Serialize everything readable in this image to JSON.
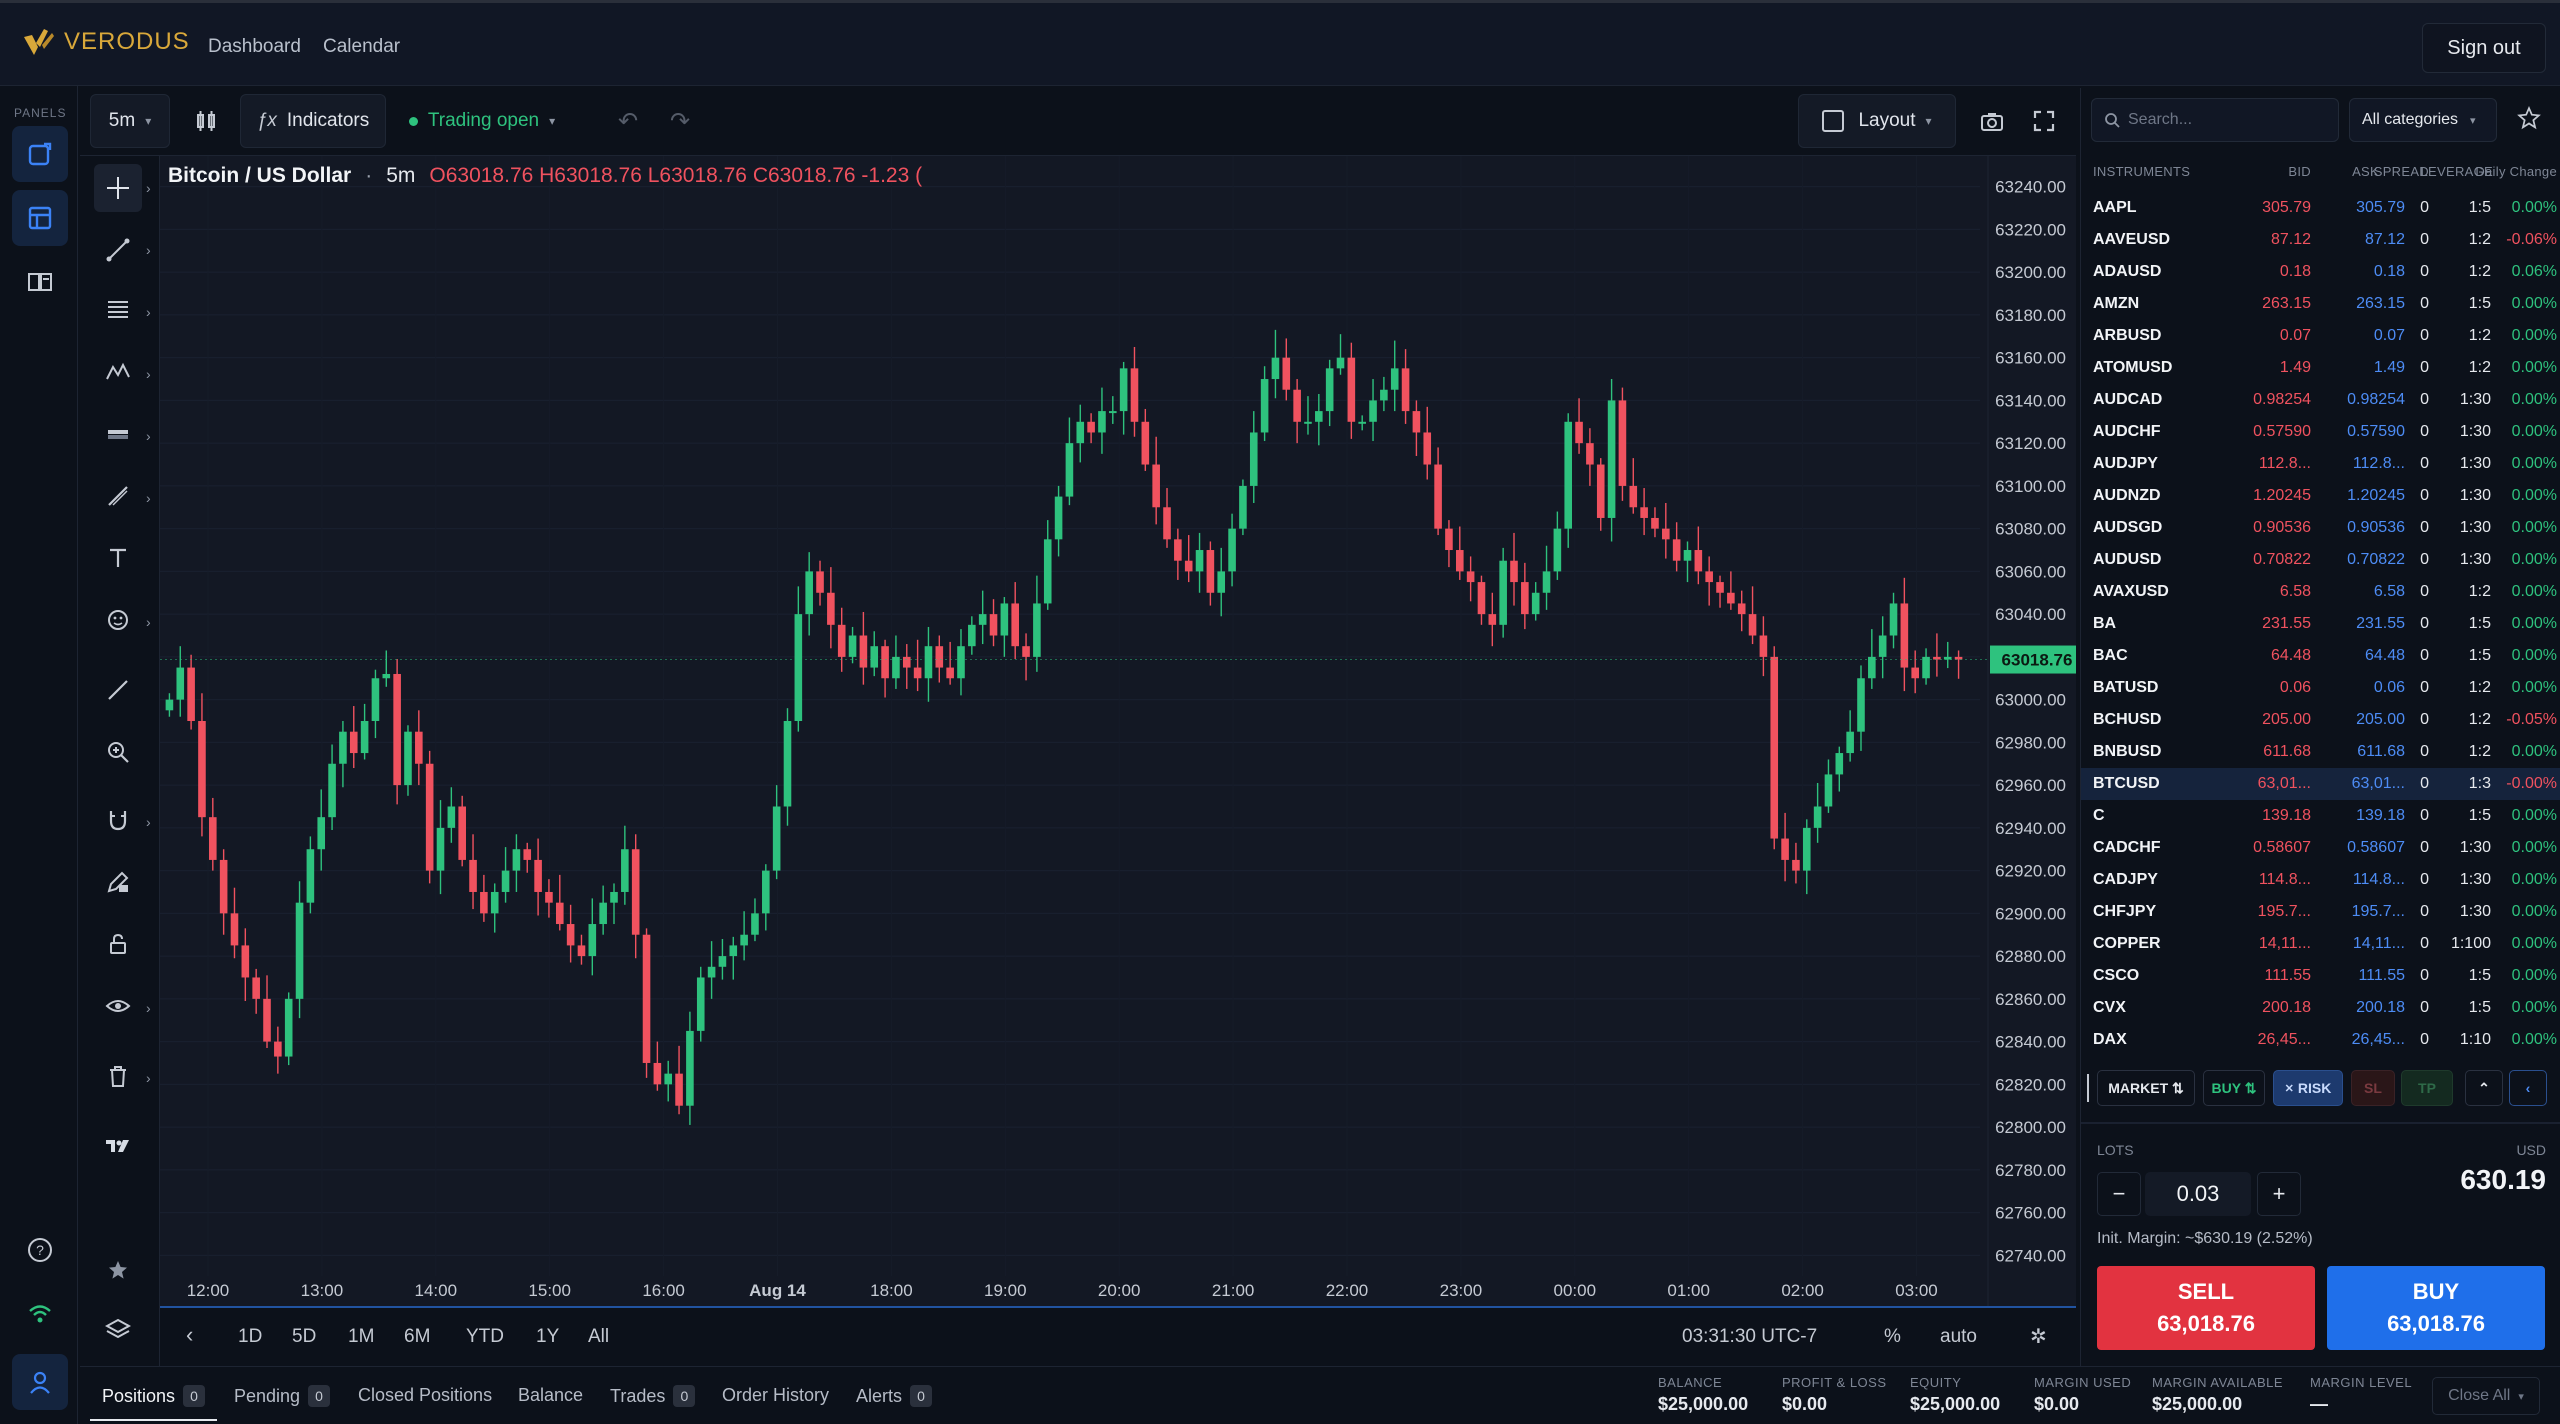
{
  "header": {
    "brand": "VERODUS",
    "nav": [
      "Dashboard",
      "Calendar"
    ],
    "sign_out": "Sign out"
  },
  "rail": {
    "label": "PANELS"
  },
  "toolbar": {
    "interval": "5m",
    "indicators": "Indicators",
    "status": "Trading open",
    "layout": "Layout"
  },
  "legend": {
    "symbol": "Bitcoin / US Dollar",
    "sep": "·",
    "interval": "5m",
    "ohlc": "O63018.76 H63018.76 L63018.76 C63018.76 -1.23 ("
  },
  "chart_data": {
    "type": "candlestick",
    "price_axis": [
      "63240.00",
      "63220.00",
      "63200.00",
      "63180.00",
      "63160.00",
      "63140.00",
      "63120.00",
      "63100.00",
      "63080.00",
      "63060.00",
      "63040.00",
      "63020.00",
      "63000.00",
      "62980.00",
      "62960.00",
      "62940.00",
      "62920.00",
      "62900.00",
      "62880.00",
      "62860.00",
      "62840.00",
      "62820.00",
      "62800.00",
      "62780.00",
      "62760.00",
      "62740.00"
    ],
    "time_axis": [
      "12:00",
      "13:00",
      "14:00",
      "15:00",
      "16:00",
      "Aug 14",
      "18:00",
      "19:00",
      "20:00",
      "21:00",
      "22:00",
      "23:00",
      "00:00",
      "01:00",
      "02:00",
      "03:00"
    ],
    "ylim": [
      62735,
      63245
    ],
    "last_price": "63018.76",
    "closes": [
      63000,
      63015,
      62990,
      62945,
      62925,
      62900,
      62885,
      62870,
      62860,
      62840,
      62833,
      62860,
      62905,
      62930,
      62945,
      62970,
      62985,
      62975,
      62990,
      63010,
      63012,
      62960,
      62985,
      62970,
      62920,
      62940,
      62950,
      62925,
      62910,
      62900,
      62910,
      62920,
      62930,
      62925,
      62910,
      62905,
      62895,
      62885,
      62880,
      62895,
      62905,
      62910,
      62930,
      62890,
      62830,
      62820,
      62825,
      62810,
      62845,
      62870,
      62875,
      62880,
      62885,
      62890,
      62900,
      62920,
      62950,
      62990,
      63040,
      63060,
      63050,
      63035,
      63020,
      63030,
      63015,
      63025,
      63010,
      63020,
      63015,
      63010,
      63025,
      63015,
      63010,
      63025,
      63035,
      63040,
      63030,
      63045,
      63025,
      63020,
      63045,
      63075,
      63095,
      63120,
      63130,
      63125,
      63135,
      63135,
      63155,
      63130,
      63110,
      63090,
      63075,
      63065,
      63060,
      63070,
      63050,
      63060,
      63080,
      63100,
      63125,
      63150,
      63160,
      63145,
      63130,
      63130,
      63135,
      63155,
      63160,
      63130,
      63130,
      63140,
      63145,
      63155,
      63135,
      63125,
      63110,
      63080,
      63070,
      63060,
      63055,
      63040,
      63035,
      63065,
      63055,
      63040,
      63050,
      63060,
      63080,
      63130,
      63120,
      63110,
      63085,
      63140,
      63100,
      63090,
      63085,
      63080,
      63075,
      63065,
      63070,
      63060,
      63055,
      63050,
      63045,
      63040,
      63030,
      63020,
      62935,
      62925,
      62920,
      62940,
      62950,
      62965,
      62975,
      62985,
      63010,
      63020,
      63030,
      63045,
      63015,
      63010,
      63020,
      63018.76,
      63020,
      63018.76
    ]
  },
  "range": {
    "buttons": [
      "1D",
      "5D",
      "1M",
      "6M",
      "YTD",
      "1Y",
      "All"
    ],
    "time": "03:31:30 UTC-7",
    "pct": "%",
    "auto": "auto"
  },
  "tabs": [
    {
      "label": "Positions",
      "count": "0"
    },
    {
      "label": "Pending",
      "count": "0"
    },
    {
      "label": "Closed Positions"
    },
    {
      "label": "Balance"
    },
    {
      "label": "Trades",
      "count": "0"
    },
    {
      "label": "Order History"
    },
    {
      "label": "Alerts",
      "count": "0"
    }
  ],
  "account": [
    {
      "label": "BALANCE",
      "value": "$25,000.00"
    },
    {
      "label": "PROFIT & LOSS",
      "value": "$0.00"
    },
    {
      "label": "EQUITY",
      "value": "$25,000.00"
    },
    {
      "label": "MARGIN USED",
      "value": "$0.00"
    },
    {
      "label": "MARGIN AVAILABLE",
      "value": "$25,000.00"
    },
    {
      "label": "MARGIN LEVEL",
      "value": "—"
    }
  ],
  "close_all": "Close All",
  "instruments": {
    "search_placeholder": "Search...",
    "category": "All categories",
    "headers": [
      "INSTRUMENTS",
      "BID",
      "ASK",
      "SPREAD",
      "LEVERAGE",
      "Daily Change"
    ],
    "rows": [
      [
        "AAPL",
        "305.79",
        "305.79",
        "0",
        "1:5",
        "0.00%"
      ],
      [
        "AAVEUSD",
        "87.12",
        "87.12",
        "0",
        "1:2",
        "-0.06%"
      ],
      [
        "ADAUSD",
        "0.18",
        "0.18",
        "0",
        "1:2",
        "0.06%"
      ],
      [
        "AMZN",
        "263.15",
        "263.15",
        "0",
        "1:5",
        "0.00%"
      ],
      [
        "ARBUSD",
        "0.07",
        "0.07",
        "0",
        "1:2",
        "0.00%"
      ],
      [
        "ATOMUSD",
        "1.49",
        "1.49",
        "0",
        "1:2",
        "0.00%"
      ],
      [
        "AUDCAD",
        "0.98254",
        "0.98254",
        "0",
        "1:30",
        "0.00%"
      ],
      [
        "AUDCHF",
        "0.57590",
        "0.57590",
        "0",
        "1:30",
        "0.00%"
      ],
      [
        "AUDJPY",
        "112.8...",
        "112.8...",
        "0",
        "1:30",
        "0.00%"
      ],
      [
        "AUDNZD",
        "1.20245",
        "1.20245",
        "0",
        "1:30",
        "0.00%"
      ],
      [
        "AUDSGD",
        "0.90536",
        "0.90536",
        "0",
        "1:30",
        "0.00%"
      ],
      [
        "AUDUSD",
        "0.70822",
        "0.70822",
        "0",
        "1:30",
        "0.00%"
      ],
      [
        "AVAXUSD",
        "6.58",
        "6.58",
        "0",
        "1:2",
        "0.00%"
      ],
      [
        "BA",
        "231.55",
        "231.55",
        "0",
        "1:5",
        "0.00%"
      ],
      [
        "BAC",
        "64.48",
        "64.48",
        "0",
        "1:5",
        "0.00%"
      ],
      [
        "BATUSD",
        "0.06",
        "0.06",
        "0",
        "1:2",
        "0.00%"
      ],
      [
        "BCHUSD",
        "205.00",
        "205.00",
        "0",
        "1:2",
        "-0.05%"
      ],
      [
        "BNBUSD",
        "611.68",
        "611.68",
        "0",
        "1:2",
        "0.00%"
      ],
      [
        "BTCUSD",
        "63,01...",
        "63,01...",
        "0",
        "1:3",
        "-0.00%"
      ],
      [
        "C",
        "139.18",
        "139.18",
        "0",
        "1:5",
        "0.00%"
      ],
      [
        "CADCHF",
        "0.58607",
        "0.58607",
        "0",
        "1:30",
        "0.00%"
      ],
      [
        "CADJPY",
        "114.8...",
        "114.8...",
        "0",
        "1:30",
        "0.00%"
      ],
      [
        "CHFJPY",
        "195.7...",
        "195.7...",
        "0",
        "1:30",
        "0.00%"
      ],
      [
        "COPPER",
        "14,11...",
        "14,11...",
        "0",
        "1:100",
        "0.00%"
      ],
      [
        "CSCO",
        "111.55",
        "111.55",
        "0",
        "1:5",
        "0.00%"
      ],
      [
        "CVX",
        "200.18",
        "200.18",
        "0",
        "1:5",
        "0.00%"
      ],
      [
        "DAX",
        "26,45...",
        "26,45...",
        "0",
        "1:10",
        "0.00%"
      ]
    ],
    "selected": "BTCUSD"
  },
  "order": {
    "market": "MARKET ⇅",
    "buy": "BUY ⇅",
    "risk": "RISK",
    "sl": "SL",
    "tp": "TP",
    "lots_label": "LOTS",
    "currency": "USD",
    "lots": "0.03",
    "amount": "630.19",
    "margin": "Init. Margin: ~$630.19 (2.52%)",
    "sell_label": "SELL",
    "sell_price": "63,018.76",
    "buy_label": "BUY",
    "buy_price": "63,018.76"
  },
  "colors": {
    "up": "#2ec27e",
    "down": "#f0525f",
    "accent": "#1f6fea",
    "brand": "#d9a83a"
  }
}
